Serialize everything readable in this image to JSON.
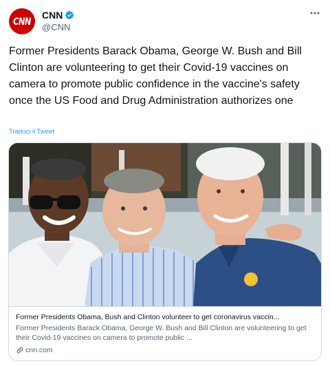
{
  "author": {
    "avatar_text": "CNN",
    "name": "CNN",
    "handle": "@CNN",
    "verified_icon": "verified-badge-icon"
  },
  "menu_icon": "more-horizontal-icon",
  "tweet": {
    "text": "Former Presidents Barack Obama, George W. Bush and Bill Clinton are volunteering to get their Covid-19 vaccines on camera to promote public confidence in the vaccine's safety once the US Food and Drug Administration authorizes one",
    "translate_label": "Traduci il Tweet"
  },
  "link_card": {
    "image": "photo of three former presidents smiling outdoors",
    "title": "Former Presidents Obama, Bush and Clinton volunteer to get coronavirus vaccin...",
    "description": "Former Presidents Barack Obama, George W. Bush and Bill Clinton are volunteering to get their Covid-19 vaccines on camera to promote public ...",
    "domain": "cnn.com",
    "domain_icon": "link-icon"
  },
  "colors": {
    "accent": "#1d9bf0",
    "brand": "#cc0000",
    "text": "#0f1419",
    "secondary": "#536471"
  }
}
